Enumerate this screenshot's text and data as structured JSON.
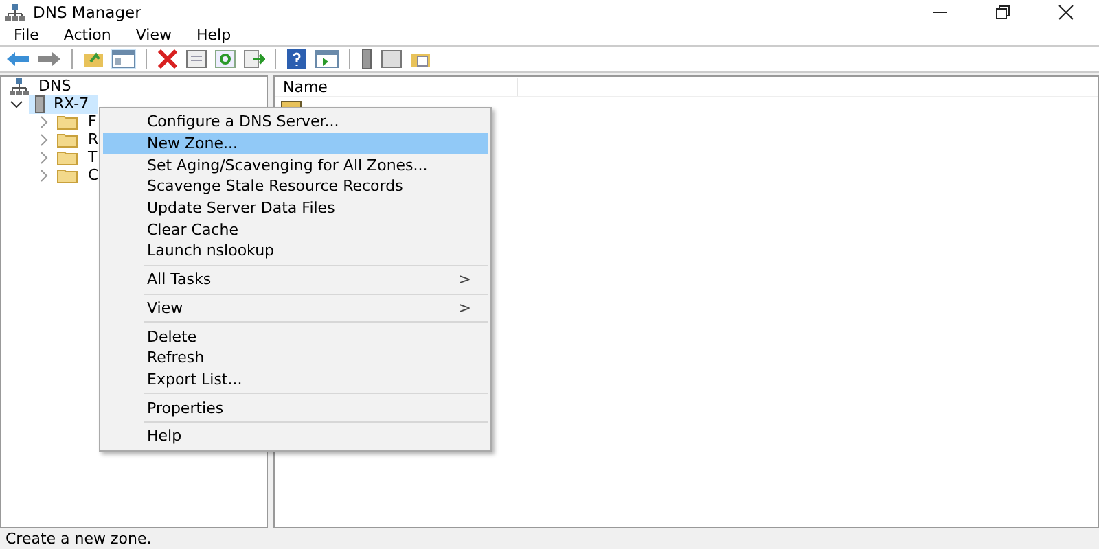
{
  "window": {
    "title": "DNS Manager"
  },
  "menu_bar": [
    "File",
    "Action",
    "View",
    "Help"
  ],
  "tree": [
    {
      "label": "DNS",
      "selected": false,
      "children": [
        {
          "label": "RX-7",
          "selected": true,
          "expanded": true,
          "children": [
            {
              "label": "F",
              "selected": false,
              "expanded": false
            },
            {
              "label": "R",
              "selected": false,
              "expanded": false
            },
            {
              "label": "T",
              "selected": false,
              "expanded": false
            },
            {
              "label": "C",
              "selected": false,
              "expanded": false
            }
          ]
        }
      ]
    }
  ],
  "list": {
    "columns": [
      "Name"
    ]
  },
  "context_menu": [
    {
      "kind": "item",
      "label": "Configure a DNS Server...",
      "selected": false
    },
    {
      "kind": "item",
      "label": "New Zone...",
      "selected": true
    },
    {
      "kind": "item",
      "label": "Set Aging/Scavenging for All Zones...",
      "selected": false
    },
    {
      "kind": "item",
      "label": "Scavenge Stale Resource Records",
      "selected": false
    },
    {
      "kind": "item",
      "label": "Update Server Data Files",
      "selected": false
    },
    {
      "kind": "item",
      "label": "Clear Cache",
      "selected": false
    },
    {
      "kind": "item",
      "label": "Launch nslookup",
      "selected": false
    },
    {
      "kind": "separator"
    },
    {
      "kind": "submenu",
      "label": "All Tasks",
      "arrow": ">",
      "selected": false
    },
    {
      "kind": "separator"
    },
    {
      "kind": "submenu",
      "label": "View",
      "arrow": ">",
      "selected": false
    },
    {
      "kind": "separator"
    },
    {
      "kind": "item",
      "label": "Delete",
      "selected": false
    },
    {
      "kind": "item",
      "label": "Refresh",
      "selected": false
    },
    {
      "kind": "item",
      "label": "Export List...",
      "selected": false
    },
    {
      "kind": "separator"
    },
    {
      "kind": "item",
      "label": "Properties",
      "selected": false
    },
    {
      "kind": "separator"
    },
    {
      "kind": "item",
      "label": "Help",
      "selected": false
    }
  ],
  "status_bar": "Create a new zone."
}
